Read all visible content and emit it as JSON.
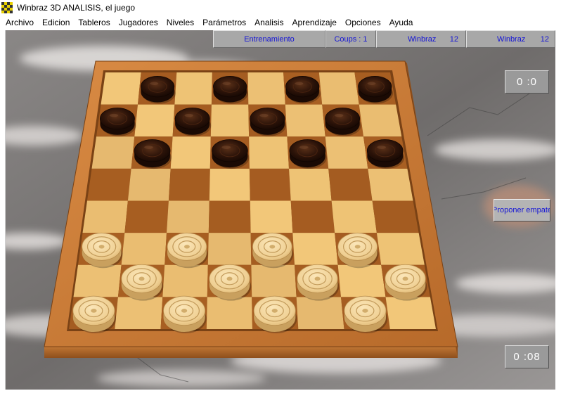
{
  "window": {
    "title": "Winbraz 3D ANALISIS, el juego",
    "icon": "checkerboard-icon"
  },
  "menu": {
    "items": [
      "Archivo",
      "Edicion",
      "Tableros",
      "Jugadores",
      "Niveles",
      "Parámetros",
      "Analisis",
      "Aprendizaje",
      "Opciones",
      "Ayuda"
    ]
  },
  "status": {
    "mode": "Entrenamiento",
    "coups": "Coups : 1",
    "player1": {
      "name": "Winbraz",
      "count": "12"
    },
    "player2": {
      "name": "Winbraz",
      "count": "12"
    }
  },
  "clocks": {
    "top": "0 :0",
    "bottom": "0 :08"
  },
  "buttons": {
    "draw_offer": "Proponer empate"
  },
  "board": {
    "size": 8,
    "dark_pieces": [
      [
        0,
        1
      ],
      [
        0,
        3
      ],
      [
        0,
        5
      ],
      [
        0,
        7
      ],
      [
        1,
        0
      ],
      [
        1,
        2
      ],
      [
        1,
        4
      ],
      [
        1,
        6
      ],
      [
        2,
        1
      ],
      [
        2,
        3
      ],
      [
        2,
        5
      ],
      [
        2,
        7
      ]
    ],
    "light_pieces": [
      [
        5,
        0
      ],
      [
        5,
        2
      ],
      [
        5,
        4
      ],
      [
        5,
        6
      ],
      [
        6,
        1
      ],
      [
        6,
        3
      ],
      [
        6,
        5
      ],
      [
        6,
        7
      ],
      [
        7,
        0
      ],
      [
        7,
        2
      ],
      [
        7,
        4
      ],
      [
        7,
        6
      ]
    ]
  },
  "colors": {
    "status_text": "#1515d6",
    "panel_bg": "#a8a8a8",
    "light_square": "#f2c779",
    "dark_square": "#a85f22",
    "frame": "#c97a33",
    "dark_piece": "#2a1208",
    "light_piece": "#f0d49c"
  }
}
